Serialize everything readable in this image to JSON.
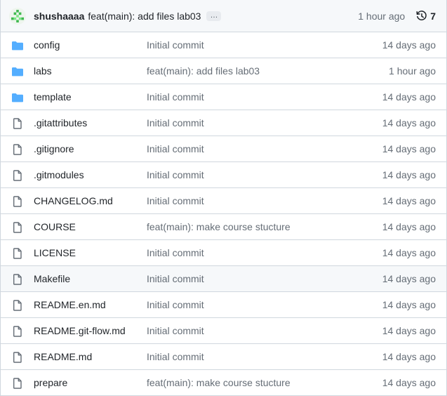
{
  "latest_commit": {
    "author": "shushaaaa",
    "message": "feat(main): add files lab03",
    "ellipsis": "…",
    "time": "1 hour ago",
    "commit_count": "7"
  },
  "colors": {
    "folder": "#54aeff",
    "file": "#656d76",
    "avatar": "#3fb950"
  },
  "files": [
    {
      "name": "config",
      "type": "folder",
      "message": "Initial commit",
      "age": "14 days ago"
    },
    {
      "name": "labs",
      "type": "folder",
      "message": "feat(main): add files lab03",
      "age": "1 hour ago"
    },
    {
      "name": "template",
      "type": "folder",
      "message": "Initial commit",
      "age": "14 days ago"
    },
    {
      "name": ".gitattributes",
      "type": "file",
      "message": "Initial commit",
      "age": "14 days ago"
    },
    {
      "name": ".gitignore",
      "type": "file",
      "message": "Initial commit",
      "age": "14 days ago"
    },
    {
      "name": ".gitmodules",
      "type": "file",
      "message": "Initial commit",
      "age": "14 days ago"
    },
    {
      "name": "CHANGELOG.md",
      "type": "file",
      "message": "Initial commit",
      "age": "14 days ago"
    },
    {
      "name": "COURSE",
      "type": "file",
      "message": "feat(main): make course stucture",
      "age": "14 days ago"
    },
    {
      "name": "LICENSE",
      "type": "file",
      "message": "Initial commit",
      "age": "14 days ago"
    },
    {
      "name": "Makefile",
      "type": "file",
      "message": "Initial commit",
      "age": "14 days ago",
      "hovered": true
    },
    {
      "name": "README.en.md",
      "type": "file",
      "message": "Initial commit",
      "age": "14 days ago"
    },
    {
      "name": "README.git-flow.md",
      "type": "file",
      "message": "Initial commit",
      "age": "14 days ago"
    },
    {
      "name": "README.md",
      "type": "file",
      "message": "Initial commit",
      "age": "14 days ago"
    },
    {
      "name": "prepare",
      "type": "file",
      "message": "feat(main): make course stucture",
      "age": "14 days ago"
    }
  ]
}
